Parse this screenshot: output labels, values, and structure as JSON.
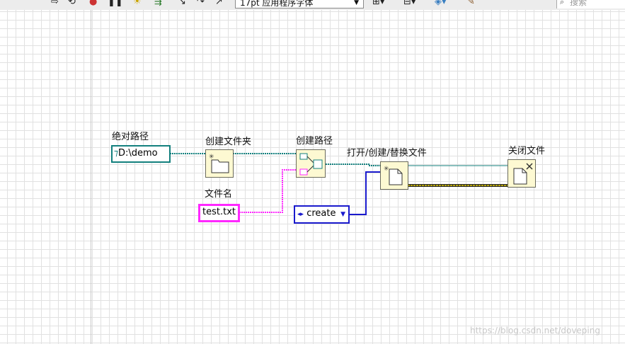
{
  "toolbar": {
    "font_selector": "17pt 应用程序字体",
    "search_placeholder": "搜索"
  },
  "nodes": {
    "absolute_path": {
      "label": "绝对路径",
      "value": "D:\\demo"
    },
    "create_folder": {
      "label": "创建文件夹"
    },
    "build_path": {
      "label": "创建路径"
    },
    "file_name": {
      "label": "文件名",
      "value": "test.txt"
    },
    "open_file": {
      "label": "打开/创建/替换文件"
    },
    "operation": {
      "value": "create"
    },
    "close_file": {
      "label": "关闭文件"
    }
  },
  "colors": {
    "path_wire": "#13807e",
    "string_wire": "#ff28ff",
    "enum_wire": "#1a1acd",
    "error_wire": "#b5a300",
    "node_fill": "#fdf9d2"
  },
  "watermark": "https://blog.csdn.net/doveping"
}
